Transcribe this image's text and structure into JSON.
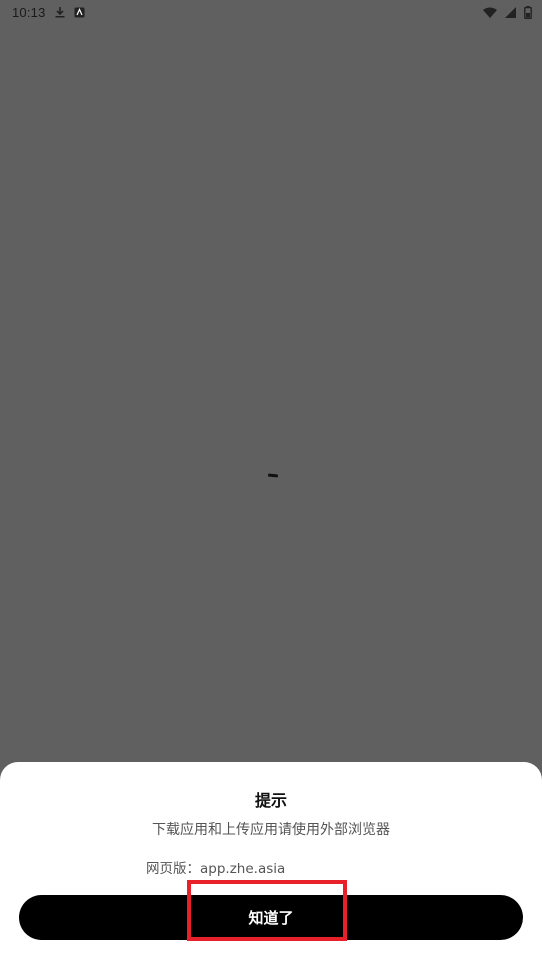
{
  "status_bar": {
    "time": "10:13",
    "left_icons": [
      "download-icon",
      "app-notification-icon"
    ],
    "right_icons": [
      "wifi-icon",
      "signal-icon",
      "battery-icon"
    ]
  },
  "dialog": {
    "title": "提示",
    "message": "下载应用和上传应用请使用外部浏览器",
    "web_label": "网页版：",
    "web_url": "app.zhe.asia",
    "confirm_label": "知道了"
  },
  "colors": {
    "overlay": "#606060",
    "sheet_bg": "#ffffff",
    "button_bg": "#000000",
    "highlight": "#e8202a"
  }
}
